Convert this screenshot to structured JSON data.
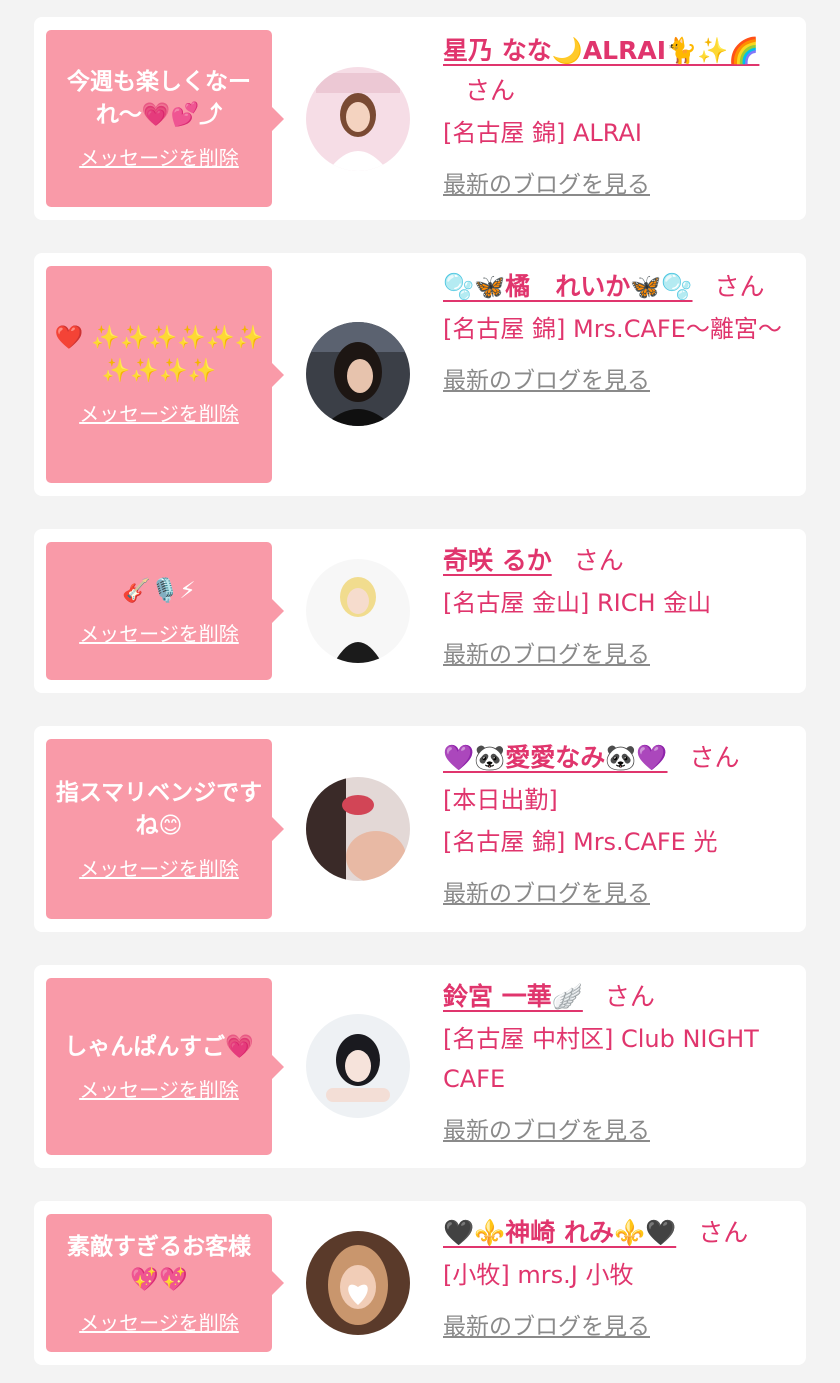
{
  "cards": [
    {
      "message": "今週も楽しくなーれ〜💗💕⤴",
      "delete_label": "メッセージを削除",
      "name": "星乃 なな🌙ALRAI🐈✨🌈",
      "honorific": "さん",
      "status": "",
      "shop": "[名古屋 錦] ALRAI",
      "blog_label": "最新のブログを見る"
    },
    {
      "message": "❤️ ✨✨✨✨✨✨ ✨✨✨✨",
      "delete_label": "メッセージを削除",
      "name": "🫧🦋橘　れいか🦋🫧",
      "honorific": "さん",
      "status": "",
      "shop": "[名古屋 錦] Mrs.CAFE〜離宮〜",
      "blog_label": "最新のブログを見る"
    },
    {
      "message": "🎸🎙️⚡",
      "delete_label": "メッセージを削除",
      "name": "奇咲 るか",
      "honorific": "さん",
      "status": "",
      "shop": "[名古屋 金山] RICH 金山",
      "blog_label": "最新のブログを見る"
    },
    {
      "message": "指スマリベンジですね😊",
      "delete_label": "メッセージを削除",
      "name": "💜🐼愛愛なみ🐼💜",
      "honorific": "さん",
      "status": "[本日出勤]",
      "shop": "[名古屋 錦] Mrs.CAFE 光",
      "blog_label": "最新のブログを見る"
    },
    {
      "message": "しゃんぱんすご💗",
      "delete_label": "メッセージを削除",
      "name": "鈴宮 一華🪽",
      "honorific": "さん",
      "status": "",
      "shop": "[名古屋 中村区] Club NIGHT CAFE",
      "blog_label": "最新のブログを見る"
    },
    {
      "message": "素敵すぎるお客様💖💖",
      "delete_label": "メッセージを削除",
      "name": "🖤⚜️神崎 れみ⚜️🖤",
      "honorific": "さん",
      "status": "",
      "shop": "[小牧] mrs.J 小牧",
      "blog_label": "最新のブログを見る"
    }
  ]
}
